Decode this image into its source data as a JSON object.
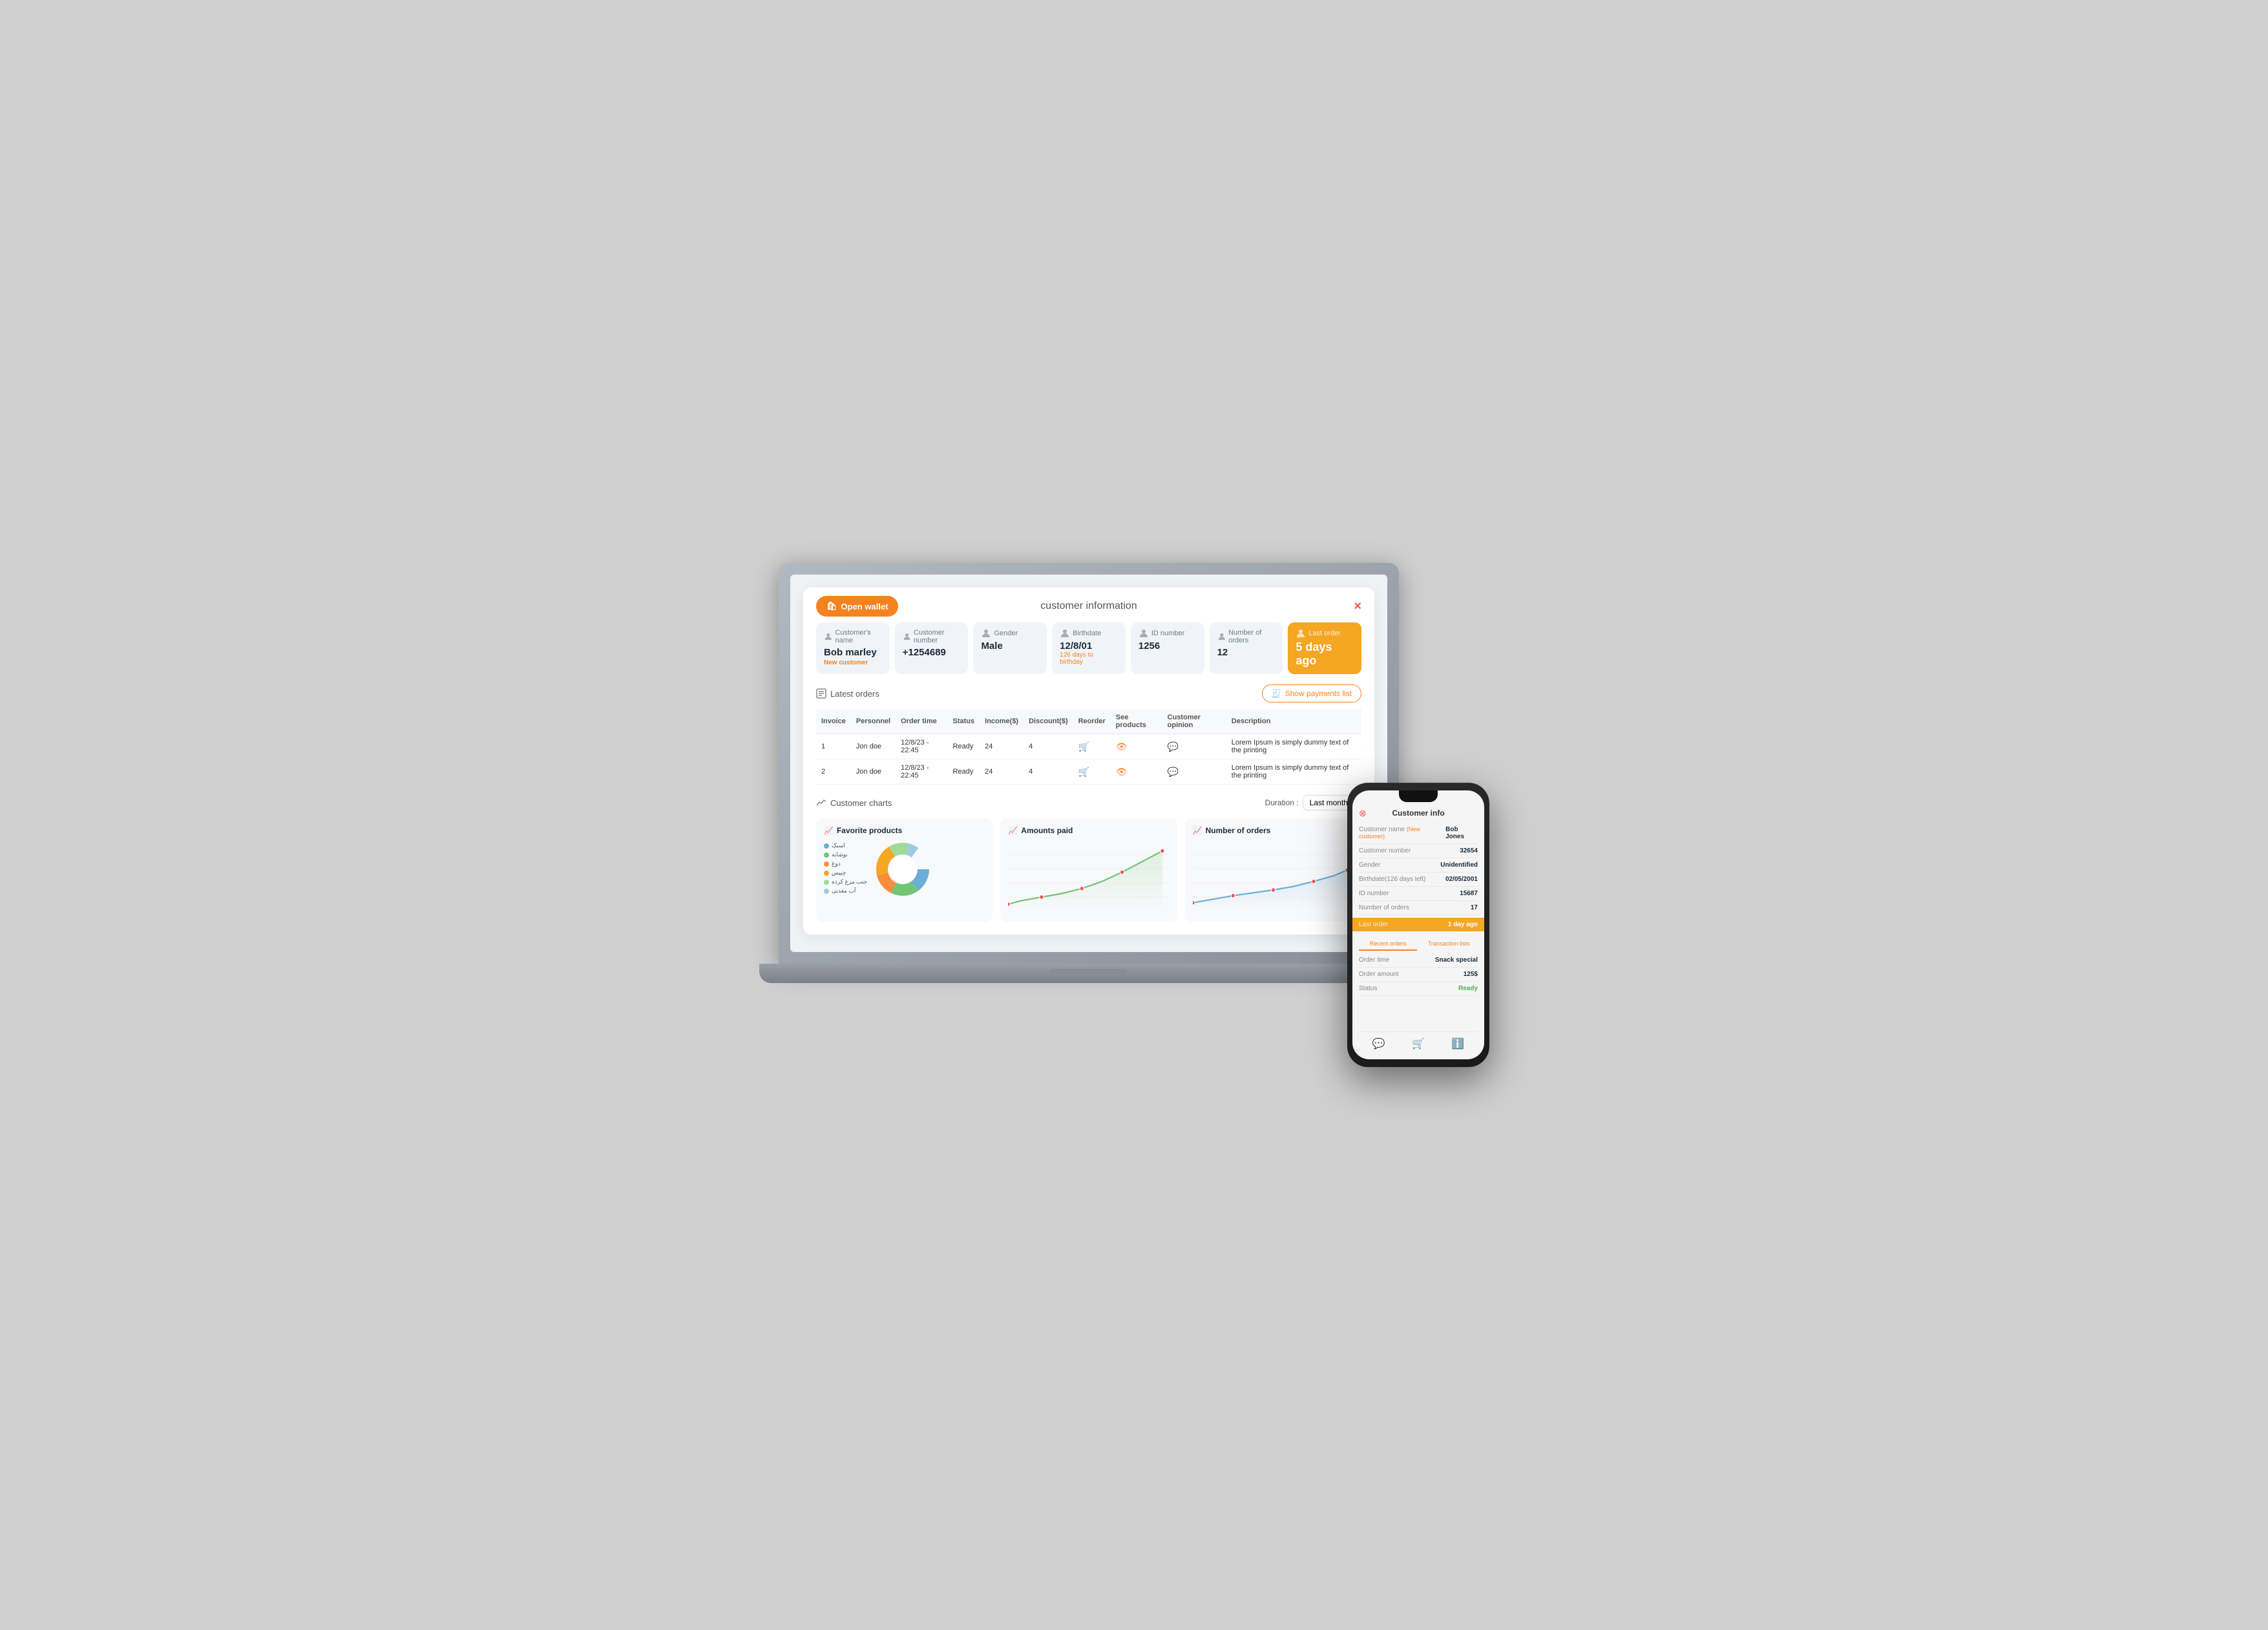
{
  "modal": {
    "title": "customer information",
    "close_label": "×",
    "open_wallet_label": "Open wallet"
  },
  "info_cards": [
    {
      "label": "Customer's name",
      "value": "Bob marley",
      "sub": "New customer",
      "highlighted": false
    },
    {
      "label": "Customer number",
      "value": "+1254689",
      "sub": "",
      "highlighted": false
    },
    {
      "label": "Gender",
      "value": "Male",
      "sub": "",
      "highlighted": false
    },
    {
      "label": "Birthdate",
      "value": "12/8/01",
      "sub": "126 days to birthday",
      "highlighted": false
    },
    {
      "label": "ID number",
      "value": "1256",
      "sub": "",
      "highlighted": false
    },
    {
      "label": "Number of orders",
      "value": "12",
      "sub": "",
      "highlighted": false
    },
    {
      "label": "Last order",
      "value": "5 days ago",
      "sub": "",
      "highlighted": true
    }
  ],
  "latest_orders": {
    "title": "Latest orders",
    "show_payments_label": "Show payments list",
    "columns": [
      "Invoice",
      "Personnel",
      "Order time",
      "Status",
      "Income($)",
      "Discount($)",
      "Reorder",
      "See products",
      "Customer opinion",
      "Description"
    ],
    "rows": [
      {
        "invoice": "1",
        "personnel": "Jon doe",
        "order_time": "12/8/23 - 22:45",
        "status": "Ready",
        "income": "24",
        "discount": "4",
        "description": "Lorem Ipsum is simply dummy text of the printing"
      },
      {
        "invoice": "2",
        "personnel": "Jon doe",
        "order_time": "12/8/23 - 22:45",
        "status": "Ready",
        "income": "24",
        "discount": "4",
        "description": "Lorem Ipsum is simply dummy text of the printing"
      }
    ]
  },
  "charts": {
    "title": "Customer charts",
    "duration_label": "Duration :",
    "duration_value": "Last month",
    "cards": [
      {
        "title": "Favorite products",
        "type": "donut",
        "legend": [
          {
            "label": "اسنک",
            "color": "#6baed6"
          },
          {
            "label": "نوشابه",
            "color": "#74c476"
          },
          {
            "label": "دوغ",
            "color": "#fd8d3c"
          },
          {
            "label": "چیپس",
            "color": "#f5a623"
          },
          {
            "label": "جنب مرغ کرده",
            "color": "#a1d99b"
          },
          {
            "label": "آب معدنی",
            "color": "#9ecae1"
          }
        ]
      },
      {
        "title": "Amounts paid",
        "type": "line"
      },
      {
        "title": "Number of orders",
        "type": "line"
      }
    ]
  },
  "phone": {
    "title": "Customer info",
    "rows": [
      {
        "label": "Customer name (New customer)",
        "value": "Bob Jones",
        "highlight": "new_customer_label"
      },
      {
        "label": "Customer number",
        "value": "32654"
      },
      {
        "label": "Gender",
        "value": "Unidentified"
      },
      {
        "label": "Birthdate(126 days left)",
        "value": "02/05/2001"
      },
      {
        "label": "ID number",
        "value": "15687"
      },
      {
        "label": "Number of orders",
        "value": "17"
      }
    ],
    "last_order": {
      "label": "Last order",
      "value": "1 day ago"
    },
    "tabs": [
      {
        "label": "Recent orders",
        "active": true
      },
      {
        "label": "Transaction lists",
        "active": false
      }
    ],
    "order_rows": [
      {
        "label": "Order time",
        "value": "Snack special"
      },
      {
        "label": "Order amount",
        "value": "125$"
      },
      {
        "label": "Status",
        "value": "Ready",
        "value_color": "green"
      }
    ]
  }
}
